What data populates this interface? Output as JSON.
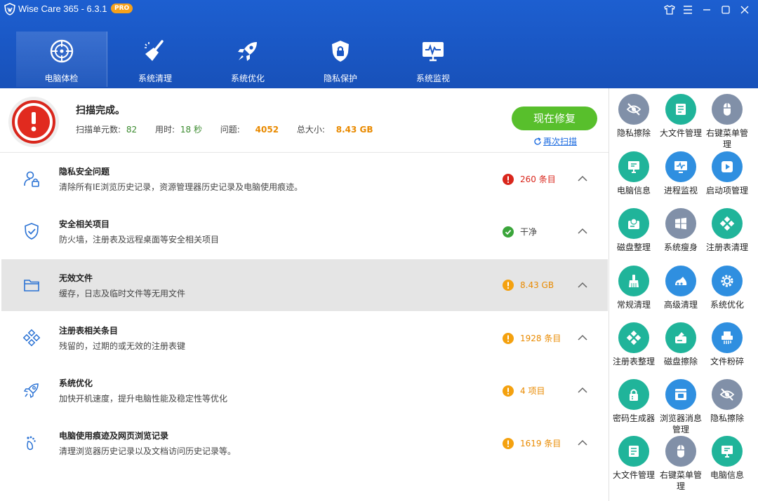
{
  "window": {
    "title": "Wise Care 365 - 6.3.1",
    "badge": "PRO"
  },
  "nav": [
    {
      "label": "电脑体检",
      "icon": "radar-icon",
      "active": true
    },
    {
      "label": "系统清理",
      "icon": "broom-icon"
    },
    {
      "label": "系统优化",
      "icon": "rocket-icon"
    },
    {
      "label": "隐私保护",
      "icon": "shield-lock-icon"
    },
    {
      "label": "系统监视",
      "icon": "monitor-pulse-icon"
    }
  ],
  "summary": {
    "title": "扫描完成。",
    "units_label": "扫描单元数:",
    "units": "82",
    "time_label": "用时:",
    "time": "18 秒",
    "issues_label": "问题:",
    "issues": "4052",
    "size_label": "总大小:",
    "size": "8.43 GB",
    "fix_label": "现在修复",
    "rescan_label": "再次扫描"
  },
  "items": [
    {
      "title": "隐私安全问题",
      "desc": "清除所有IE浏览历史记录，资源管理器历史记录及电脑使用痕迹。",
      "status": "260 条目",
      "level": "error",
      "icon": "user-lock-icon"
    },
    {
      "title": "安全相关项目",
      "desc": "防火墙，注册表及远程桌面等安全相关项目",
      "status": "干净",
      "level": "ok",
      "icon": "shield-check-icon"
    },
    {
      "title": "无效文件",
      "desc": "缓存，日志及临时文件等无用文件",
      "status": "8.43 GB",
      "level": "warn",
      "icon": "folder-icon"
    },
    {
      "title": "注册表相关条目",
      "desc": "残留的，过期的或无效的注册表键",
      "status": "1928 条目",
      "level": "warn",
      "icon": "registry-icon"
    },
    {
      "title": "系统优化",
      "desc": "加快开机速度，提升电脑性能及稳定性等优化",
      "status": "4 项目",
      "level": "warn",
      "icon": "rocket-outline-icon"
    },
    {
      "title": "电脑使用痕迹及网页浏览记录",
      "desc": "清理浏览器历史记录以及文档访问历史记录等。",
      "status": "1619 条目",
      "level": "warn",
      "icon": "footprint-icon"
    }
  ],
  "colors": {
    "header": "#1a57c4",
    "error": "#d9261c",
    "ok": "#3aa53a",
    "warn": "#f4a10f",
    "teal": "#20b49a",
    "blue": "#2f8fe0",
    "grey": "#8190a8",
    "fix": "#58bf2c"
  },
  "tools": [
    {
      "label": "隐私擦除",
      "icon": "eye-off-icon",
      "color": "grey"
    },
    {
      "label": "大文件管理",
      "icon": "file-list-icon",
      "color": "teal"
    },
    {
      "label": "右键菜单管理",
      "icon": "mouse-icon",
      "color": "grey"
    },
    {
      "label": "电脑信息",
      "icon": "computer-info-icon",
      "color": "teal"
    },
    {
      "label": "进程监视",
      "icon": "process-monitor-icon",
      "color": "blue"
    },
    {
      "label": "启动项管理",
      "icon": "play-icon",
      "color": "blue"
    },
    {
      "label": "磁盘整理",
      "icon": "disk-defrag-icon",
      "color": "teal"
    },
    {
      "label": "系统瘦身",
      "icon": "windows-icon",
      "color": "grey"
    },
    {
      "label": "注册表清理",
      "icon": "registry-clean-icon",
      "color": "teal"
    },
    {
      "label": "常规清理",
      "icon": "brush-icon",
      "color": "teal"
    },
    {
      "label": "高级清理",
      "icon": "advanced-clean-icon",
      "color": "blue"
    },
    {
      "label": "系统优化",
      "icon": "gear-icon",
      "color": "blue"
    },
    {
      "label": "注册表整理",
      "icon": "registry-defrag-icon",
      "color": "teal"
    },
    {
      "label": "磁盘擦除",
      "icon": "disk-wipe-icon",
      "color": "teal"
    },
    {
      "label": "文件粉碎",
      "icon": "shredder-icon",
      "color": "blue"
    },
    {
      "label": "密码生成器",
      "icon": "lock-icon",
      "color": "teal"
    },
    {
      "label": "浏览器消息管理",
      "icon": "browser-notify-icon",
      "color": "blue"
    },
    {
      "label": "隐私擦除",
      "icon": "eye-off-icon",
      "color": "grey"
    },
    {
      "label": "大文件管理",
      "icon": "file-list-icon",
      "color": "teal"
    },
    {
      "label": "右键菜单管理",
      "icon": "mouse-icon",
      "color": "grey"
    },
    {
      "label": "电脑信息",
      "icon": "computer-info-icon",
      "color": "teal"
    }
  ]
}
